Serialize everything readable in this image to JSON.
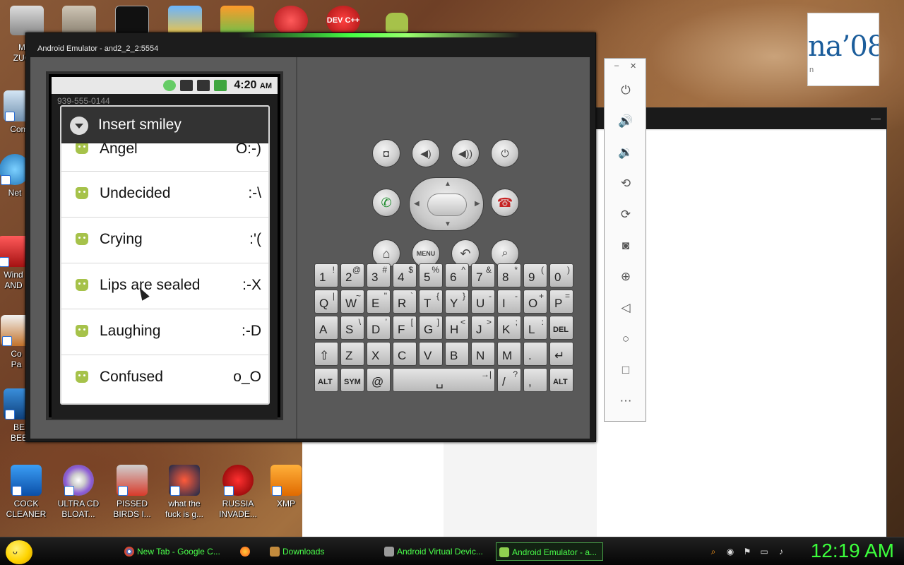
{
  "desktop": {
    "icons": [
      {
        "name": "cock-cleaner",
        "label_1": "COCK",
        "label_2": "CLEANER"
      },
      {
        "name": "ultra-cd-bloat",
        "label_1": "ULTRA CD",
        "label_2": "BLOAT..."
      },
      {
        "name": "pissed-birds",
        "label_1": "PISSED",
        "label_2": "BIRDS I..."
      },
      {
        "name": "what-the",
        "label_1": "what the",
        "label_2": "fuck is g..."
      },
      {
        "name": "russia-invade",
        "label_1": "RUSSIA",
        "label_2": "INVADE..."
      },
      {
        "name": "xmp",
        "label_1": "XMP",
        "label_2": ""
      }
    ],
    "left_icons": [
      {
        "label_1": "MA",
        "label_2": "ZUCK"
      },
      {
        "label_1": "Com",
        "label_2": ""
      },
      {
        "label_1": "Net",
        "label_2": ""
      },
      {
        "label_1": "Wind",
        "label_2": "AND"
      },
      {
        "label_1": "Co",
        "label_2": "Pa"
      },
      {
        "label_1": "BE",
        "label_2": "BEE"
      }
    ],
    "logo_text": "na’08",
    "logo_sub": "n",
    "top_icon_text": "DEV C++"
  },
  "emulator": {
    "title": "Android Emulator - and2_2_2:5554",
    "status_time": "4:20",
    "status_ampm": "AM",
    "phone_number": "939-555-0144",
    "dialog_title": "Insert smiley",
    "smileys": [
      {
        "name": "Angel",
        "code": "O:-)"
      },
      {
        "name": "Undecided",
        "code": ":-\\"
      },
      {
        "name": "Crying",
        "code": ":'("
      },
      {
        "name": "Lips are sealed",
        "code": ":-X"
      },
      {
        "name": "Laughing",
        "code": ":-D"
      },
      {
        "name": "Confused",
        "code": "o_O"
      }
    ],
    "menu_label": "MENU",
    "keyboard": {
      "row1": [
        [
          "1",
          "!"
        ],
        [
          "2",
          "@"
        ],
        [
          "3",
          "#"
        ],
        [
          "4",
          "$"
        ],
        [
          "5",
          "%"
        ],
        [
          "6",
          "^"
        ],
        [
          "7",
          "&"
        ],
        [
          "8",
          "*"
        ],
        [
          "9",
          "("
        ],
        [
          "0",
          ")"
        ]
      ],
      "row2": [
        [
          "Q",
          "|"
        ],
        [
          "W",
          "~"
        ],
        [
          "E",
          "\""
        ],
        [
          "R",
          "`"
        ],
        [
          "T",
          "{"
        ],
        [
          "Y",
          "}"
        ],
        [
          "U",
          "-"
        ],
        [
          "I",
          "-"
        ],
        [
          "O",
          "+"
        ],
        [
          "P",
          "="
        ]
      ],
      "row3": [
        [
          "A",
          ""
        ],
        [
          "S",
          "\\"
        ],
        [
          "D",
          "’"
        ],
        [
          "F",
          "["
        ],
        [
          "G",
          "]"
        ],
        [
          "H",
          "<"
        ],
        [
          "J",
          ">"
        ],
        [
          "K",
          ";"
        ],
        [
          "L",
          ":"
        ],
        [
          "DEL",
          ""
        ]
      ],
      "row4": [
        [
          "⇧",
          ""
        ],
        [
          "Z",
          ""
        ],
        [
          "X",
          ""
        ],
        [
          "C",
          ""
        ],
        [
          "V",
          ""
        ],
        [
          "B",
          ""
        ],
        [
          "N",
          ""
        ],
        [
          "M",
          ""
        ],
        [
          ".",
          ""
        ],
        [
          "↵",
          ""
        ]
      ],
      "row5": [
        [
          "ALT",
          ""
        ],
        [
          "SYM",
          ""
        ],
        [
          "@",
          ""
        ],
        [
          "␣",
          "→|"
        ],
        [
          "/",
          "?"
        ],
        [
          ",",
          ""
        ],
        [
          "ALT",
          ""
        ]
      ]
    }
  },
  "taskbar": {
    "tasks": [
      {
        "label": "New Tab - Google C...",
        "color": "#e0452a"
      },
      {
        "label": "",
        "color": "#ff7a1a"
      },
      {
        "label": "Downloads",
        "color": "#c28a3c"
      },
      {
        "label": "Android Virtual Devic...",
        "color": "#9a9a9a"
      },
      {
        "label": "Android Emulator - a...",
        "color": "#8fd14f"
      }
    ],
    "clock": "12:19 AM"
  },
  "colors": {
    "taskbar_text": "#4aff4a",
    "clock": "#3cff3c",
    "android_green": "#a6c24a"
  }
}
